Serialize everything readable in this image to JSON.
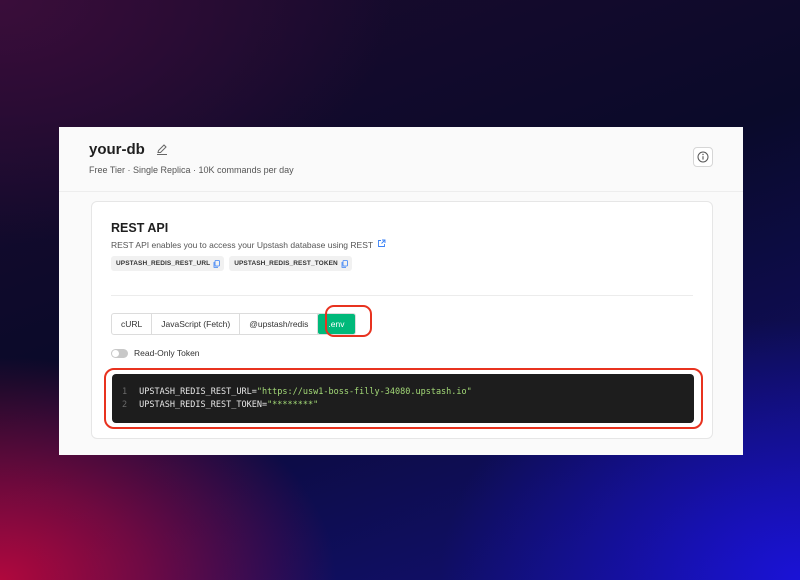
{
  "header": {
    "db_name": "your-db",
    "subtitle": "Free Tier · Single Replica · 10K commands per day"
  },
  "rest_api": {
    "title": "REST API",
    "description": "REST API enables you to access your Upstash database using REST",
    "env_vars": [
      {
        "label": "UPSTASH_REDIS_REST_URL"
      },
      {
        "label": "UPSTASH_REDIS_REST_TOKEN"
      }
    ],
    "tabs": [
      {
        "label": "cURL",
        "active": false
      },
      {
        "label": "JavaScript (Fetch)",
        "active": false
      },
      {
        "label": "@upstash/redis",
        "active": false
      },
      {
        "label": ".env",
        "active": true
      }
    ],
    "toggle": {
      "label": "Read-Only Token",
      "on": false
    },
    "code": {
      "lines": [
        {
          "num": "1",
          "key": "UPSTASH_REDIS_REST_URL=",
          "value": "\"https://usw1-boss-filly-34080.upstash.io\""
        },
        {
          "num": "2",
          "key": "UPSTASH_REDIS_REST_TOKEN=",
          "value": "\"********\""
        }
      ]
    }
  },
  "colors": {
    "accent": "#00b97a",
    "highlight": "#e8321f",
    "link": "#3b82f6"
  }
}
